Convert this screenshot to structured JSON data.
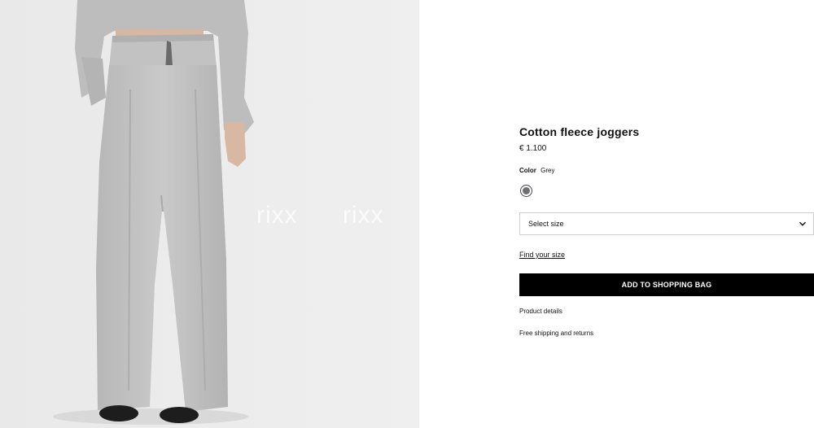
{
  "product": {
    "name": "Cotton fleece joggers",
    "price": "€ 1.100",
    "color_label": "Color",
    "color_value": "Grey",
    "swatch_color": "#6f6f72"
  },
  "gallery": {
    "watermarks": [
      "rixx",
      "rixx"
    ]
  },
  "size": {
    "placeholder": "Select size",
    "find_size_link": "Find your size"
  },
  "actions": {
    "add_to_bag": "ADD TO SHOPPING BAG"
  },
  "sections": {
    "product_details": "Product details",
    "shipping": "Free shipping and returns"
  }
}
